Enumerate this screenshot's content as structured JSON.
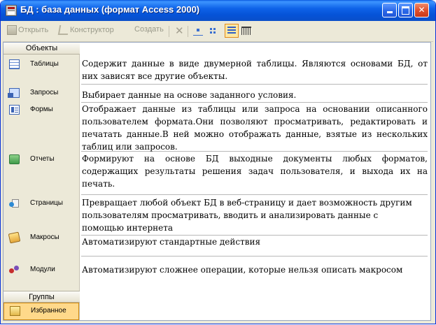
{
  "window": {
    "title": "БД : база данных (формат Access 2000)",
    "minimize_label": "",
    "maximize_label": "",
    "close_label": "✕"
  },
  "toolbar": {
    "open_label": "Открыть",
    "design_label": "Конструктор",
    "create_label": "Создать",
    "delete_icon": "✕"
  },
  "objects_bar": {
    "header": "Объекты",
    "groups_header": "Группы",
    "items": [
      {
        "label": "Таблицы",
        "icon": "table-icon"
      },
      {
        "label": "Запросы",
        "icon": "query-icon"
      },
      {
        "label": "Формы",
        "icon": "form-icon"
      },
      {
        "label": "Отчеты",
        "icon": "report-icon"
      },
      {
        "label": "Страницы",
        "icon": "page-icon"
      },
      {
        "label": "Макросы",
        "icon": "macro-icon"
      },
      {
        "label": "Модули",
        "icon": "module-icon"
      }
    ],
    "favorite": {
      "label": "Избранное",
      "icon": "favorites-folder-icon"
    }
  },
  "descriptions": [
    "Содержит данные в виде двумерной таблицы. Являются основами БД, от них зависят все другие объекты.",
    "Выбирает данные на основе заданного условия.",
    "Отображает данные из таблицы или запроса на основании описанного пользователем формата.Они позволяют просматривать, редактировать и печатать данные.В ней можно отображать данные, взятые из нескольких таблиц или запросов.",
    "Формируют на основе БД выходные документы любых форматов, содержащих результаты решения задач пользователя, и выхода их на печать.",
    "Превращает любой объект БД в веб-страницу и дает возможность другим пользователям просматривать, вводить и анализировать данные с помощью интернета",
    "Автоматизируют стандартные действия",
    "Автоматизируют сложнее операции, которые нельзя описать макросом"
  ],
  "colors": {
    "titlebar": "#0553d8",
    "close_button": "#e0502d",
    "panel": "#ece9d8",
    "selected": "#ffd98a"
  }
}
